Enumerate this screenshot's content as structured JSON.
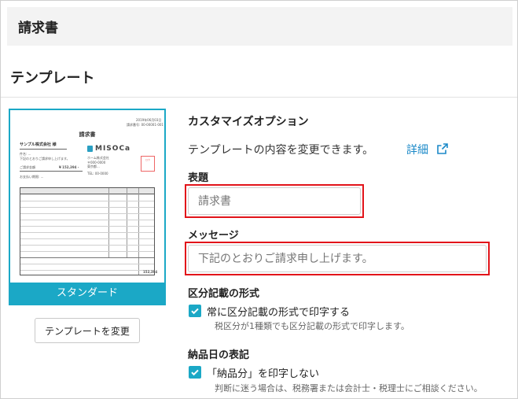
{
  "header": {
    "title": "請求書"
  },
  "section": {
    "title": "テンプレート"
  },
  "template": {
    "name": "スタンダード",
    "change_button": "テンプレートを変更",
    "preview": {
      "doc_title": "請求書",
      "client": "サンプル株式会社 様",
      "logo": "MISOCa",
      "date": "2019年06月03日",
      "number": "請求番号: 00-00001-001",
      "amount_label": "ご請求金額",
      "amount": "¥ 152,394 -",
      "stamp": "ロカ",
      "total": "152,394"
    }
  },
  "options": {
    "heading": "カスタマイズオプション",
    "description": "テンプレートの内容を変更できます。",
    "detail_link": "詳細",
    "title_field": {
      "label": "表題",
      "placeholder": "請求書"
    },
    "message_field": {
      "label": "メッセージ",
      "placeholder": "下記のとおりご請求申し上げます。"
    },
    "tax_section": {
      "label": "区分記載の形式",
      "checkbox_label": "常に区分記載の形式で印字する",
      "note": "税区分が1種類でも区分記載の形式で印字します。",
      "checked": true
    },
    "delivery_section": {
      "label": "納品日の表記",
      "checkbox_label": "「納品分」を印字しない",
      "note": "判断に迷う場合は、税務署または会計士・税理士にご相談ください。",
      "checked": true
    }
  },
  "colors": {
    "accent": "#1ba8c6",
    "highlight": "#e2141a",
    "link": "#1b89c8"
  }
}
